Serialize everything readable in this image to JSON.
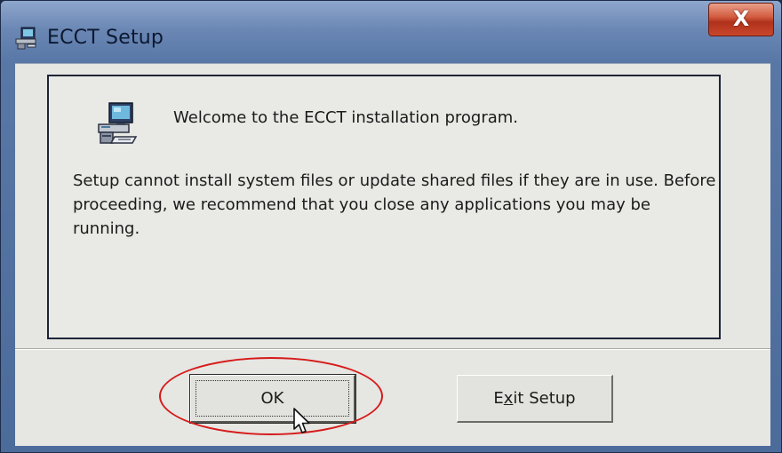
{
  "window": {
    "title": "ECCT Setup",
    "icon": "setup-computer-icon",
    "close_label": "X"
  },
  "content": {
    "welcome": "Welcome to the ECCT installation program.",
    "message_line1": "Setup cannot install system files or update shared files if they are in use.  Before",
    "message_line2": "proceeding, we recommend that you close any applications you may be running."
  },
  "buttons": {
    "ok": {
      "label": "OK"
    },
    "exit": {
      "prefix": "E",
      "accel": "x",
      "suffix": "it Setup"
    }
  },
  "annotation": {
    "color": "#d61a1a",
    "shape": "ellipse-around-ok-button"
  }
}
